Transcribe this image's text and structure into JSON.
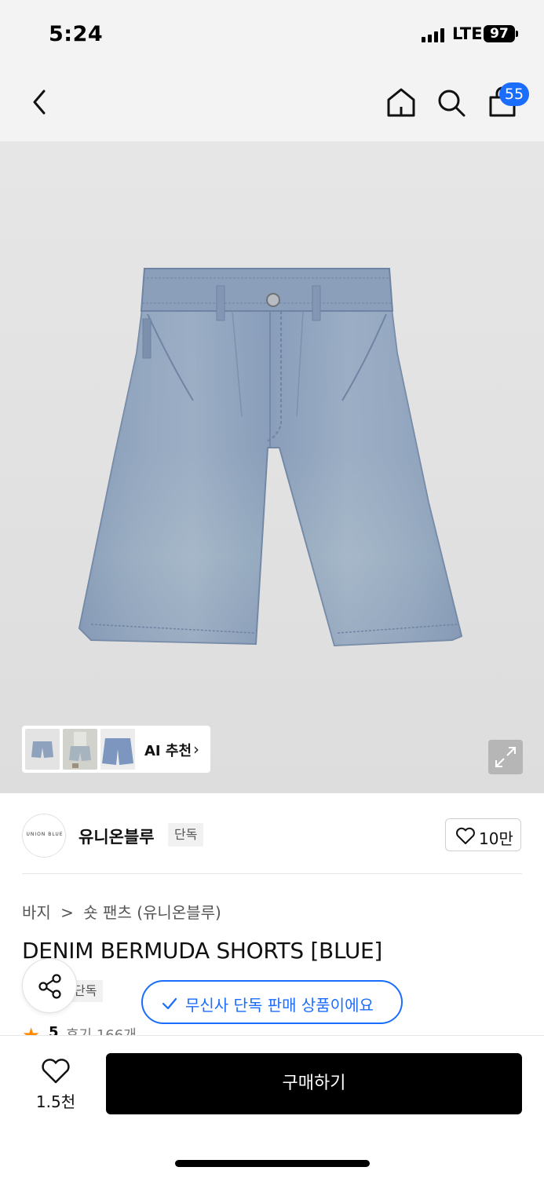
{
  "status_bar": {
    "time": "5:24",
    "network": "LTE",
    "battery": "97"
  },
  "nav": {
    "back_icon": "chevron-left-icon",
    "home_icon": "home-icon",
    "search_icon": "search-icon",
    "cart_icon": "shopping-bag-icon",
    "cart_count": "55"
  },
  "gallery": {
    "ai_label": "AI 추천",
    "chevron": "›"
  },
  "seller": {
    "logo_text": "UNION BLUE",
    "name": "유니온블루",
    "badge": "단독",
    "like_count": "10만"
  },
  "breadcrumb": {
    "category": "바지",
    "separator": ">",
    "subcategory": "숏 팬츠 (유니온블루)"
  },
  "product": {
    "title": "DENIM BERMUDA SHORTS [BLUE]",
    "exclusive_tag": "단독",
    "exclusive_notice": "무신사 단독 판매 상품이에요",
    "rating": "5",
    "reviews": "후기 166개"
  },
  "bottom": {
    "like_count": "1.5천",
    "buy_label": "구매하기"
  },
  "colors": {
    "accent_blue": "#1a6dff",
    "rating_orange": "#ff8a00",
    "buy_button": "#000000"
  }
}
